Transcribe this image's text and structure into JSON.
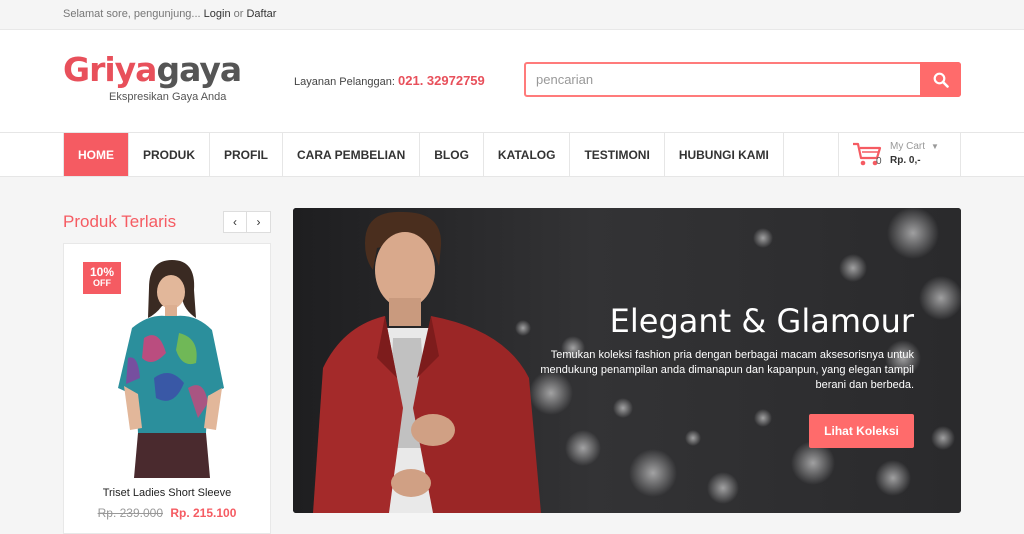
{
  "topbar": {
    "greeting": "Selamat sore, pengunjung...",
    "login": "Login",
    "or": "or",
    "register": "Daftar"
  },
  "logo": {
    "part1": "Griya",
    "part2": "gaya",
    "tagline": "Ekspresikan Gaya Anda"
  },
  "customer_service": {
    "label": "Layanan Pelanggan:",
    "phone": "021. 32972759"
  },
  "search": {
    "placeholder": "pencarian",
    "icon": "search-icon"
  },
  "nav": {
    "items": [
      "HOME",
      "PRODUK",
      "PROFIL",
      "CARA PEMBELIAN",
      "BLOG",
      "KATALOG",
      "TESTIMONI",
      "HUBUNGI KAMI"
    ],
    "active_index": 0
  },
  "cart": {
    "title": "My Cart",
    "caret": "▼",
    "count": "0",
    "total": "Rp. 0,-",
    "icon": "cart-icon"
  },
  "sidebar": {
    "title": "Produk Terlaris",
    "prev": "‹",
    "next": "›",
    "product": {
      "badge_pct": "10%",
      "badge_off": "OFF",
      "name": "Triset Ladies Short Sleeve",
      "old_price": "Rp. 239.000",
      "new_price": "Rp. 215.100"
    }
  },
  "banner": {
    "title": "Elegant & Glamour",
    "description": "Temukan koleksi fashion pria dengan berbagai macam aksesorisnya untuk mendukung penampilan anda dimanapun dan kapanpun, yang elegan tampil berani dan berbeda.",
    "button": "Lihat Koleksi"
  },
  "colors": {
    "accent": "#f55b62",
    "button": "#ff6b6b",
    "banner_bg": "#2a2a2c"
  }
}
